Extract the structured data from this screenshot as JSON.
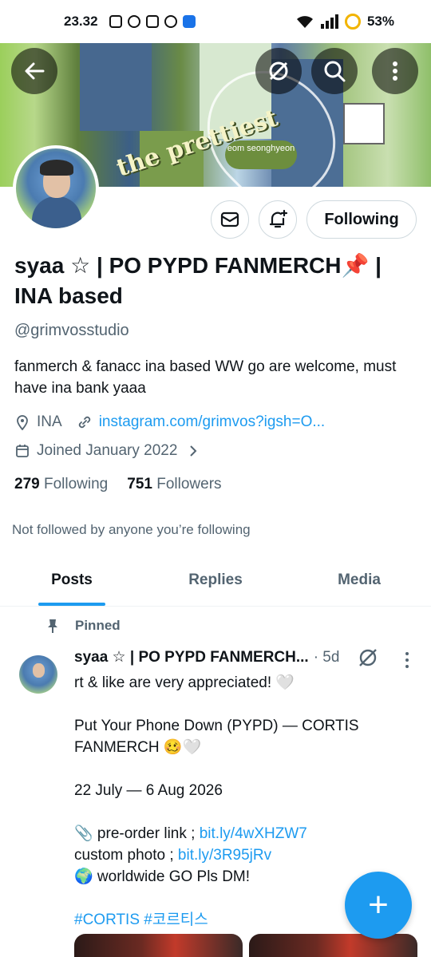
{
  "status_bar": {
    "time": "23.32",
    "battery": "53%"
  },
  "banner": {
    "script_text": "the prettiest",
    "tag_text": "eom seonghyeon"
  },
  "profile": {
    "name": "syaa ☆ | PO PYPD FANMERCH📌 | INA based",
    "handle": "@grimvosstudio",
    "bio": "fanmerch & fanacc ina based  WW go are welcome, must have ina bank yaaa",
    "location": "INA",
    "website": "instagram.com/grimvos?igsh=O...",
    "joined": "Joined January 2022",
    "following_count": "279",
    "following_label": "Following",
    "followers_count": "751",
    "followers_label": "Followers",
    "not_followed": "Not followed by anyone you’re following",
    "follow_button": "Following"
  },
  "tabs": [
    "Posts",
    "Replies",
    "Media"
  ],
  "tweet": {
    "pinned_label": "Pinned",
    "name": "syaa ☆ | PO PYPD FANMERCH...",
    "time": "· 5d",
    "lines": [
      "rt & like are very appreciated! 🤍",
      "",
      "Put Your Phone Down (PYPD) — CORTIS",
      "FANMERCH 🥴🤍",
      "",
      "22 July — 6 Aug 2026",
      "",
      "📎 pre-order link ; ",
      "custom photo ; ",
      "🌍 worldwide GO Pls DM!",
      "",
      ""
    ],
    "link1": "bit.ly/4wXHZW7",
    "link2": "bit.ly/3R95jRv",
    "hashtags": "#CORTIS #코르티스"
  },
  "fab_label": "+"
}
